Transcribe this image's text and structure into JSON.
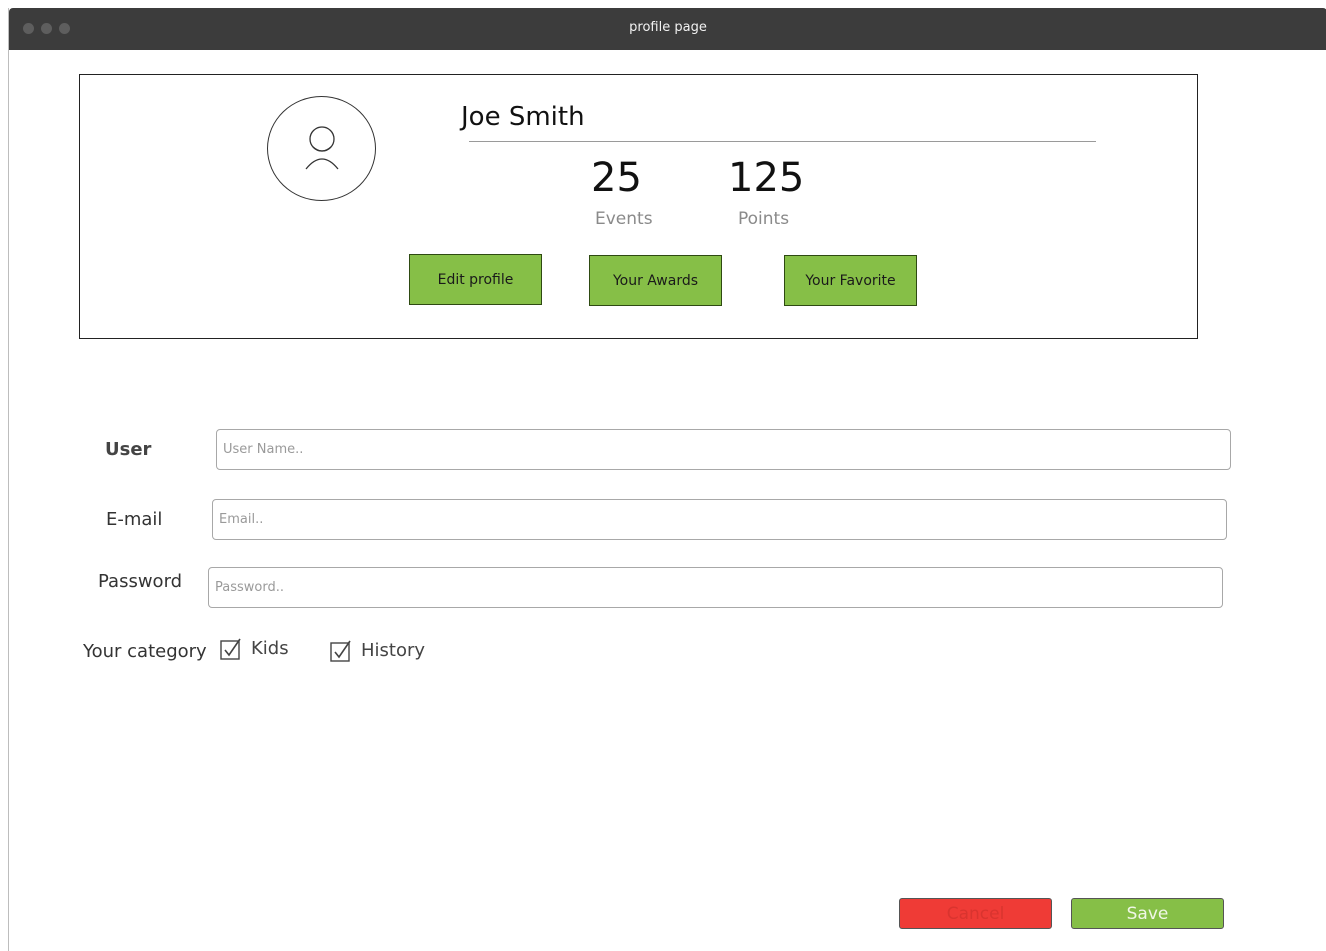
{
  "window": {
    "title": "profile page"
  },
  "profile": {
    "name": "Joe Smith",
    "stats": [
      {
        "value": "25",
        "label": "Events"
      },
      {
        "value": "125",
        "label": "Points"
      }
    ],
    "buttons": {
      "edit": "Edit profile",
      "awards": "Your Awards",
      "favorite": "Your Favorite"
    }
  },
  "form": {
    "user": {
      "label": "User",
      "placeholder": "User Name.."
    },
    "email": {
      "label": "E-mail",
      "placeholder": "Email.."
    },
    "password": {
      "label": "Password",
      "placeholder": "Password.."
    },
    "category": {
      "label": "Your category",
      "options": [
        {
          "label": "Kids",
          "checked": true
        },
        {
          "label": "History",
          "checked": true
        }
      ]
    }
  },
  "footer": {
    "cancel": "Cancel",
    "save": "Save"
  },
  "colors": {
    "accent_green": "#86bf47",
    "cancel_red": "#ef3b36",
    "titlebar": "#3c3c3c"
  }
}
